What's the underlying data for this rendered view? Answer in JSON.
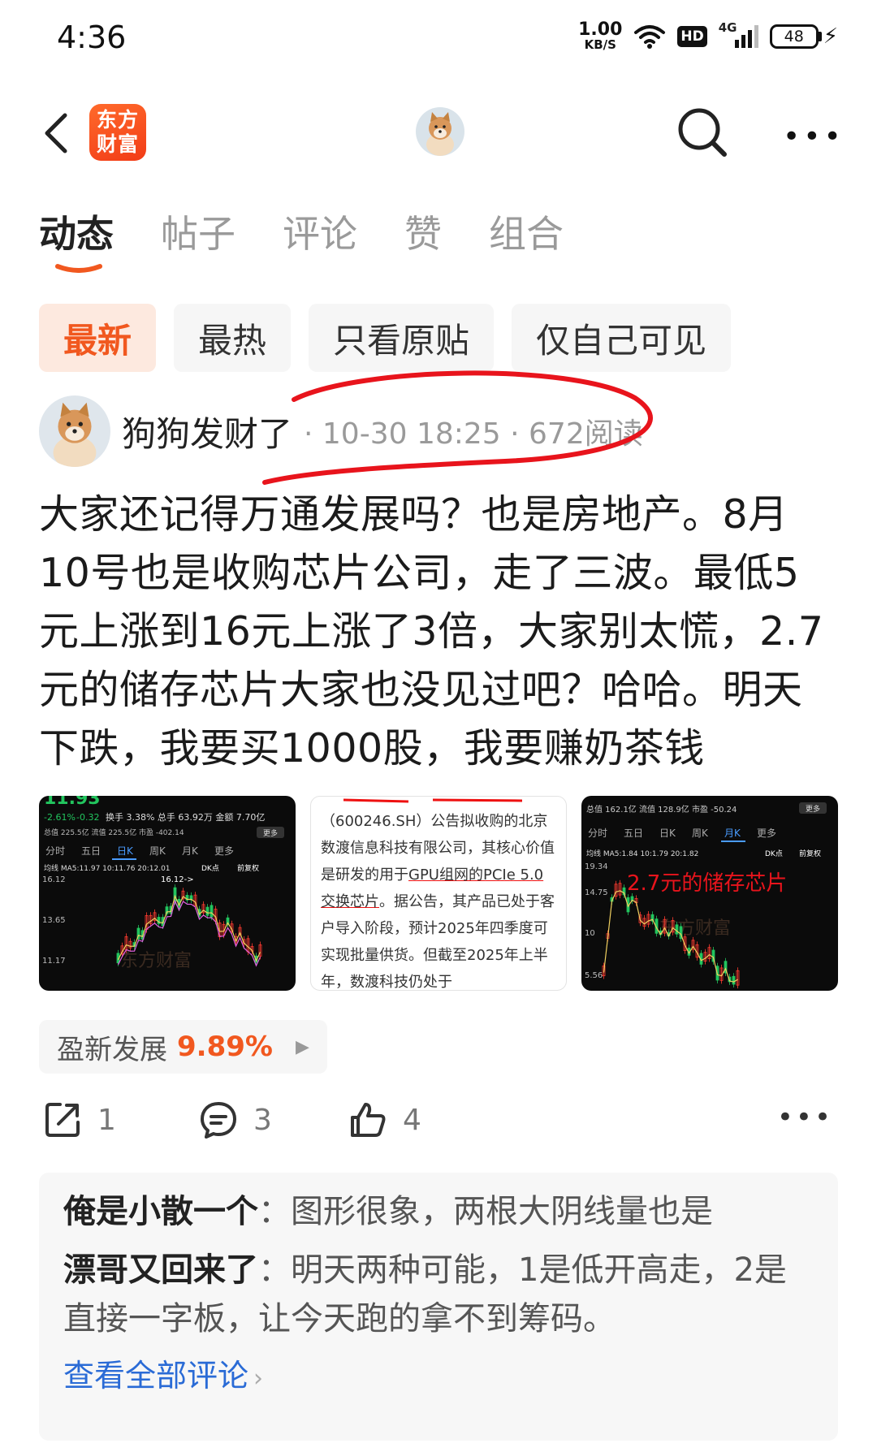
{
  "status_bar": {
    "time": "4:36",
    "net_speed": "1.00",
    "net_unit": "KB/S",
    "hd": "HD",
    "network": "4G",
    "battery": "48"
  },
  "header": {
    "logo_text": "东方财富"
  },
  "tabs": [
    {
      "label": "动态",
      "active": true
    },
    {
      "label": "帖子"
    },
    {
      "label": "评论"
    },
    {
      "label": "赞"
    },
    {
      "label": "组合"
    }
  ],
  "filters": [
    {
      "label": "最新",
      "active": true
    },
    {
      "label": "最热"
    },
    {
      "label": "只看原贴"
    },
    {
      "label": "仅自己可见"
    }
  ],
  "post": {
    "author": "狗狗发财了",
    "meta": "· 10-30 18:25 · 672阅读",
    "content": "大家还记得万通发展吗？也是房地产。8月10号也是收购芯片公司，走了三波。最低5元上涨到16元上涨了3倍，大家别太慌，2.7元的储存芯片大家也没见过吧？哈哈。明天下跌，我要买1000股，我要赚奶茶钱",
    "images": {
      "chart1": {
        "price": "11.93",
        "change_pct": "-2.61%",
        "change": "-0.32",
        "row1": "换手 3.38%  总手 63.92万  金额 7.70亿",
        "row2": "总值 225.5亿  流值 225.5亿  市盈 -402.14",
        "more": "更多",
        "tabs": [
          "分时",
          "五日",
          "日K",
          "周K",
          "月K",
          "更多"
        ],
        "ma_line": "均线  MA5:11.97  10:11.76  20:12.01",
        "dk": "DK点",
        "fq": "前复权",
        "y_labels": [
          "16.12",
          "13.65",
          "11.17"
        ],
        "peak": "16.12->",
        "watermark": "东方财富"
      },
      "text_image": {
        "p1": "（600246.SH）公告拟收购的北京数渡信息科技有限公司，其核心价值是研发的用于",
        "underlined": "GPU组网的PCIe 5.0交换芯片",
        "p2": "。据公告，其产品已处于客户导入阶段，预计2025年四季度可实现批量供货。但截至2025年上半年，数渡科技仍处于"
      },
      "chart2": {
        "row1": "总值 162.1亿  流值 128.9亿  市盈 -50.24",
        "more": "更多",
        "tabs": [
          "分时",
          "五日",
          "日K",
          "周K",
          "月K",
          "更多"
        ],
        "ma_line": "均线  MA5:1.84  10:1.79  20:1.82",
        "dk": "DK点",
        "fq": "前复权",
        "y_labels": [
          "19.34",
          "14.75",
          "10",
          "5.56"
        ],
        "overlay": "2.7元的储存芯片",
        "watermark": "东方财富"
      }
    },
    "stock": {
      "name": "盈新发展",
      "change": "9.89%"
    },
    "actions": {
      "share": "1",
      "comment": "3",
      "like": "4"
    }
  },
  "comments": [
    {
      "user": "俺是小散一个",
      "sep": "：",
      "text": "图形很象，两根大阴线量也是"
    },
    {
      "user": "漂哥又回来了",
      "sep": "：",
      "text": "明天两种可能，1是低开高走，2是直接一字板，让今天跑的拿不到筹码。"
    }
  ],
  "view_all": "查看全部评论",
  "colors": {
    "accent": "#f1581f",
    "link": "#2a6bd6",
    "annotation": "#e8141c",
    "up": "#ff3b30",
    "down": "#22c55e"
  }
}
